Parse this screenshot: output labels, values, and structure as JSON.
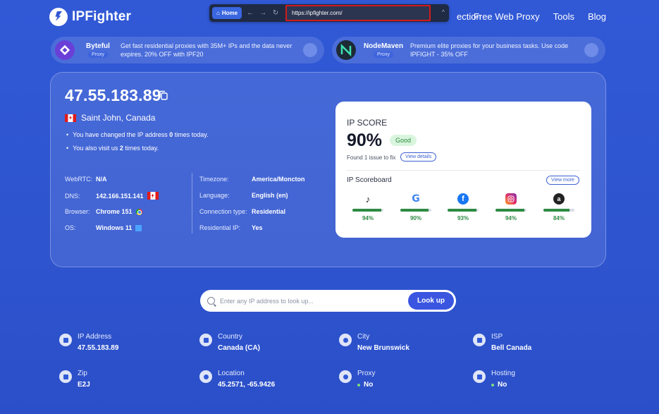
{
  "header": {
    "logo": "IPFighter",
    "nav": [
      "ection",
      "Free Web Proxy",
      "Tools",
      "Blog"
    ]
  },
  "browser": {
    "home_label": "Home",
    "url": "https://ipfighter.com/"
  },
  "promos": [
    {
      "name": "Byteful",
      "badge": "Proxy",
      "text": "Get fast residential proxies with 35M+ IPs and the data never expires. 20% OFF with IPF20"
    },
    {
      "name": "NodeMaven",
      "badge": "Proxy",
      "text": "Premium elite proxies for your business tasks. Use code IPFIGHT - 35% OFF"
    }
  ],
  "ip_info": {
    "ip": "47.55.183.89",
    "location": "Saint John, Canada",
    "bullet1_a": "You have changed the IP address ",
    "bullet1_b": "0",
    "bullet1_c": " times today.",
    "bullet2_a": "You also visit us ",
    "bullet2_b": "2",
    "bullet2_c": " times today.",
    "left": [
      {
        "k": "WebRTC:",
        "v": "N/A"
      },
      {
        "k": "DNS:",
        "v": "142.166.151.141"
      },
      {
        "k": "Browser:",
        "v": "Chrome 151"
      },
      {
        "k": "OS:",
        "v": "Windows 11"
      }
    ],
    "right": [
      {
        "k": "Timezone:",
        "v": "America/Moncton"
      },
      {
        "k": "Language:",
        "v": "English (en)"
      },
      {
        "k": "Connection type:",
        "v": "Residential"
      },
      {
        "k": "Residential IP:",
        "v": "Yes"
      }
    ]
  },
  "score": {
    "title": "IP SCORE",
    "value": "90%",
    "badge": "Good",
    "issue": "Found 1 issue to fix",
    "details": "View details",
    "board_title": "IP Scoreboard",
    "more": "View more",
    "sites": [
      {
        "icon": "tiktok-icon",
        "pct": "94%",
        "fill": 0.94,
        "color": "#111111"
      },
      {
        "icon": "google-icon",
        "pct": "90%",
        "fill": 0.9,
        "color": "#4285f4"
      },
      {
        "icon": "facebook-icon",
        "pct": "93%",
        "fill": 0.93,
        "color": "#1877f2"
      },
      {
        "icon": "instagram-icon",
        "pct": "94%",
        "fill": 0.94,
        "color": "#d6249f"
      },
      {
        "icon": "amazon-icon",
        "pct": "84%",
        "fill": 0.84,
        "color": "#222222"
      }
    ]
  },
  "search": {
    "placeholder": "Enter any IP address to look up...",
    "button": "Look up"
  },
  "details": [
    {
      "k": "IP Address",
      "v": "47.55.183.89"
    },
    {
      "k": "Country",
      "v": "Canada (CA)"
    },
    {
      "k": "City",
      "v": "New Brunswick"
    },
    {
      "k": "ISP",
      "v": "Bell Canada"
    },
    {
      "k": "Zip",
      "v": "E2J"
    },
    {
      "k": "Location",
      "v": "45.2571, -65.9426"
    },
    {
      "k": "Proxy",
      "v": "No"
    },
    {
      "k": "Hosting",
      "v": "No"
    }
  ]
}
